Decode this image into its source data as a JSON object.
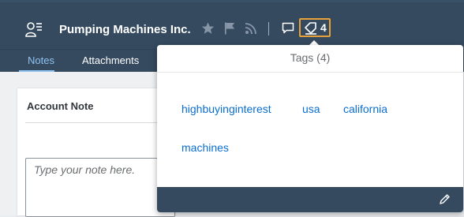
{
  "header": {
    "title": "Pumping Machines Inc.",
    "tag_count": "4"
  },
  "tabs": [
    {
      "label": "Notes",
      "active": true
    },
    {
      "label": "Attachments",
      "active": false
    }
  ],
  "card": {
    "title": "Account Note",
    "note_placeholder": "Type your note here."
  },
  "popover": {
    "title": "Tags (4)",
    "tags": [
      "highbuyinginterest",
      "usa",
      "california",
      "machines"
    ]
  },
  "colors": {
    "header_bg": "#354a5f",
    "accent": "#e7a13a",
    "link": "#0a6ed1",
    "active_tab": "#8fc2ef"
  }
}
